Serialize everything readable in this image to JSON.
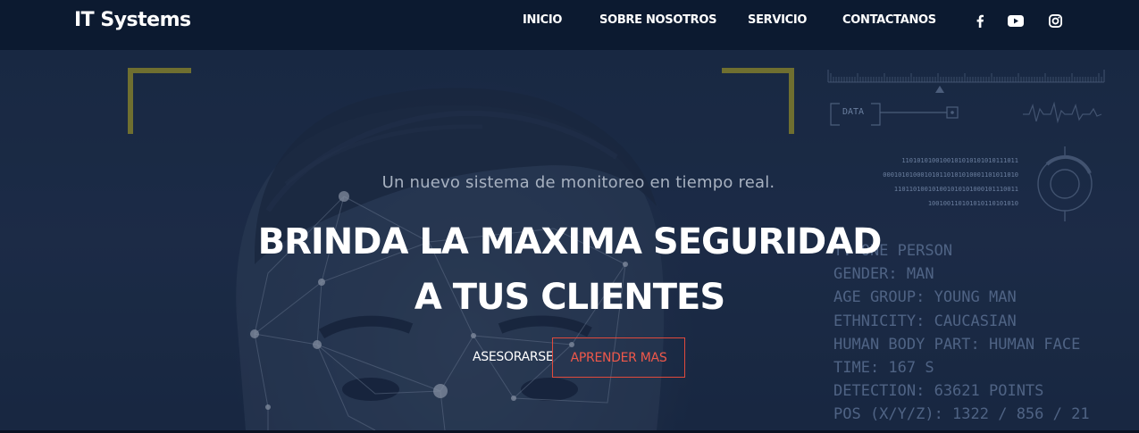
{
  "navbar": {
    "brand": "IT Systems",
    "links": [
      "INICIO",
      "SOBRE NOSOTROS",
      "SERVICIO",
      "CONTACTANOS"
    ],
    "social_icons": [
      "facebook-icon",
      "youtube-icon",
      "instagram-icon"
    ]
  },
  "hero": {
    "subtitle": "Un nuevo sistema de monitoreo en tiempo real.",
    "headline_line1": "BRINDA LA MAXIMA SEGURIDAD",
    "headline_line2": "A TUS CLIENTES",
    "primary_button": "ASESORARSE",
    "secondary_button": "APRENDER MAS",
    "background_hud": {
      "data_label": "DATA",
      "info_lines": [
        "T: ONE PERSON",
        "GENDER: MAN",
        "AGE GROUP: YOUNG MAN",
        "ETHNICITY: CAUCASIAN",
        "HUMAN BODY PART: HUMAN FACE",
        "TIME: 167 S",
        "DETECTION: 63621 POINTS",
        "POS (X/Y/Z): 1322 / 856 / 21"
      ],
      "binary_lines": [
        "1101010100100101010101010111011",
        "000101010001010110101010001101011010",
        "110110100101001010101000101110011",
        "100100110101010110101010",
        "1010101011001"
      ]
    }
  },
  "colors": {
    "navbar_bg": "#0c1a30",
    "hero_bg": "#1d2d48",
    "accent": "#e04a3c",
    "corner_brackets": "#a19a2c",
    "hud_text": "#4f6384"
  }
}
